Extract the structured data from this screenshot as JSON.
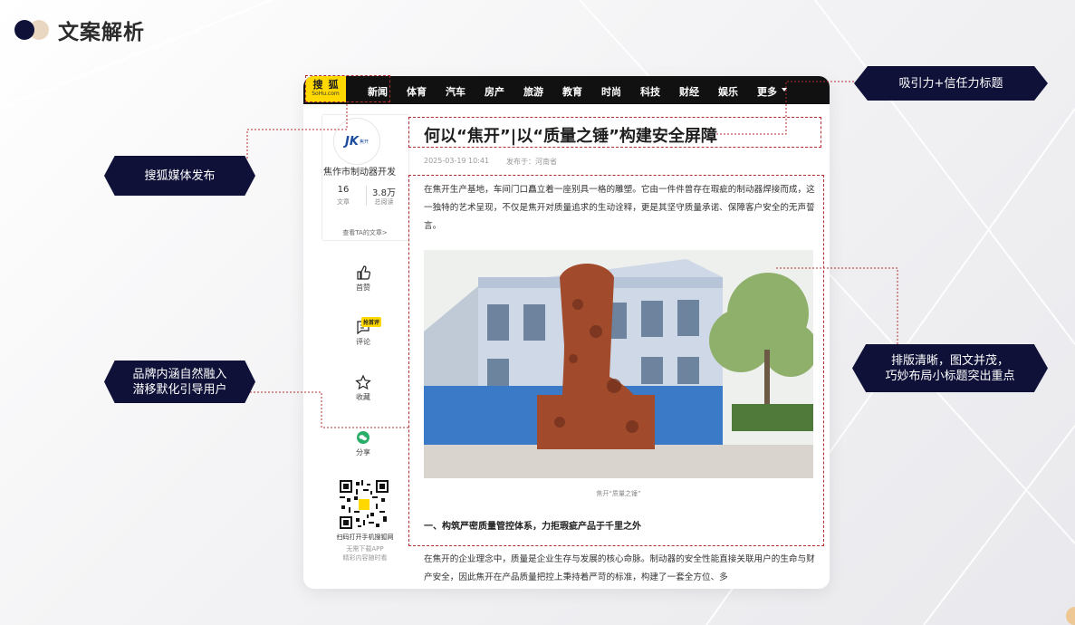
{
  "slide": {
    "title": "文案解析"
  },
  "nav": {
    "logo_top": "搜狐",
    "logo_bottom": "SoHu.com",
    "items": [
      "新闻",
      "体育",
      "汽车",
      "房产",
      "旅游",
      "教育",
      "时尚",
      "科技",
      "财经",
      "娱乐",
      "更多"
    ]
  },
  "author": {
    "logo": "JK",
    "logo_sub": "焦开",
    "name": "焦作市制动器开发",
    "articles_count": "16",
    "articles_label": "文章",
    "reads_count": "3.8万",
    "reads_label": "总阅读",
    "profile_link": "查看TA的文章>"
  },
  "actions": {
    "like": "首赞",
    "comment": "评论",
    "hot_tag": "抢首评",
    "favorite": "收藏",
    "share": "分享"
  },
  "qr": {
    "title": "扫码打开手机搜狐网",
    "sub1": "无需下载APP",
    "sub2": "精彩内容随时看"
  },
  "article": {
    "title": "何以“焦开”|以“质量之锤”构建安全屏障",
    "date": "2025-03-19 10:41",
    "source": "发布于：河南省",
    "p1": "在焦开生产基地，车间门口矗立着一座别具一格的雕塑。它由一件件曾存在瑕疵的制动器焊接而成，这一独特的艺术呈现，不仅是焦开对质量追求的生动诠释，更是其坚守质量承诺、保障客户安全的无声誓言。",
    "image_caption": "焦开“质量之锤”",
    "h2": "一、构筑严密质量管控体系，力拒瑕疵产品于千里之外",
    "p2": "在焦开的企业理念中，质量是企业生存与发展的核心命脉。制动器的安全性能直接关联用户的生命与财产安全，因此焦开在产品质量把控上秉持着严苛的标准，构建了一套全方位、多"
  },
  "callouts": {
    "title_note": "吸引力+信任力标题",
    "media_note": "搜狐媒体发布",
    "brand_note_line1": "品牌内涵自然融入",
    "brand_note_line2": "潜移默化引导用户",
    "layout_note_line1": "排版清晰，图文并茂，",
    "layout_note_line2": "巧妙布局小标题突出重点"
  },
  "colors": {
    "accent_dark": "#0f1138",
    "logo_yellow": "#ffd800",
    "annotation_red": "#b03030"
  }
}
